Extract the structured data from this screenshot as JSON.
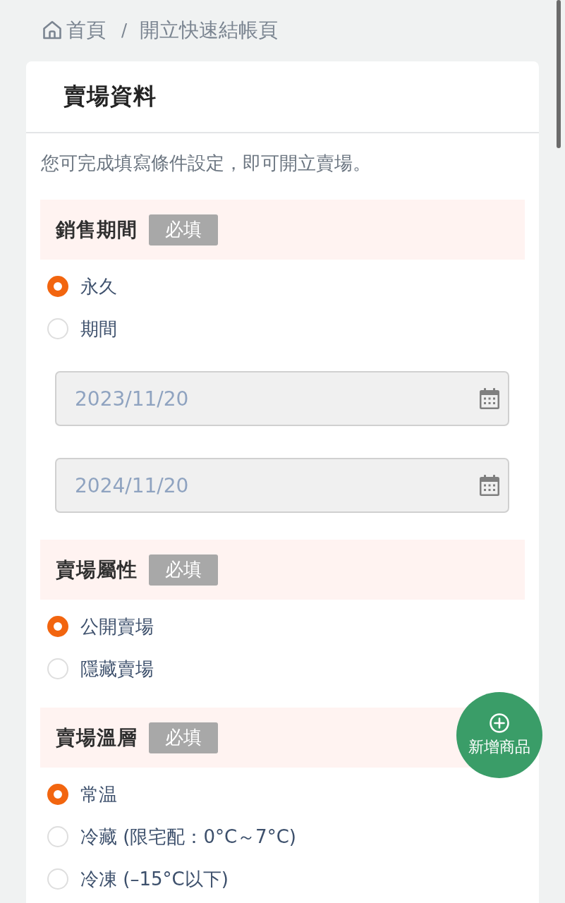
{
  "breadcrumb": {
    "separator": "/",
    "items": [
      {
        "label": "首頁",
        "kind": "home"
      },
      {
        "label": "開立快速結帳頁",
        "kind": "current"
      }
    ]
  },
  "card": {
    "title": "賣場資料",
    "description": "您可完成填寫條件設定，即可開立賣場。",
    "sections": [
      {
        "title": "銷售期間",
        "badge": "必填",
        "options": [
          {
            "label": "永久",
            "selected": true
          },
          {
            "label": "期間",
            "selected": false
          }
        ],
        "date_fields": [
          {
            "value": "2023/11/20",
            "disabled": true
          },
          {
            "value": "2024/11/20",
            "disabled": true
          }
        ]
      },
      {
        "title": "賣場屬性",
        "badge": "必填",
        "options": [
          {
            "label": "公開賣場",
            "selected": true
          },
          {
            "label": "隱藏賣場",
            "selected": false
          }
        ]
      },
      {
        "title": "賣場溫層",
        "badge": "必填",
        "options": [
          {
            "label": "常温",
            "selected": true
          },
          {
            "label": "冷藏 (限宅配：0°C～7°C)",
            "selected": false
          },
          {
            "label": "冷凍 (–15°C以下)",
            "selected": false
          }
        ]
      }
    ]
  },
  "fab": {
    "label": "新增商品"
  }
}
